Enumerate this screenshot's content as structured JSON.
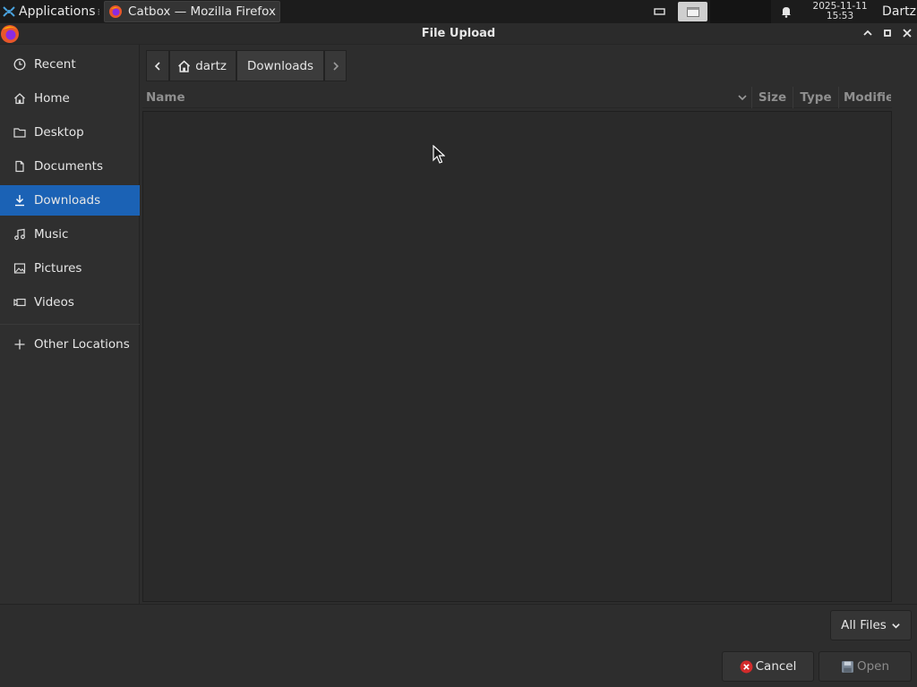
{
  "taskbar": {
    "applications_label": "Applications",
    "separator_glyph": "⁝",
    "active_window_title": "Catbox — Mozilla Firefox",
    "clock_date": "2025-11-11",
    "clock_time": "15:53",
    "user_name": "Dartz"
  },
  "dialog": {
    "title": "File Upload"
  },
  "sidebar": {
    "items": [
      {
        "label": "Recent",
        "icon": "clock-icon"
      },
      {
        "label": "Home",
        "icon": "home-icon"
      },
      {
        "label": "Desktop",
        "icon": "folder-icon"
      },
      {
        "label": "Documents",
        "icon": "document-icon"
      },
      {
        "label": "Downloads",
        "icon": "download-icon",
        "selected": true
      },
      {
        "label": "Music",
        "icon": "music-icon"
      },
      {
        "label": "Pictures",
        "icon": "picture-icon"
      },
      {
        "label": "Videos",
        "icon": "video-icon"
      }
    ],
    "other_locations": {
      "label": "Other Locations",
      "icon": "plus-icon"
    }
  },
  "pathbar": {
    "home_label": "dartz",
    "current_label": "Downloads"
  },
  "file_list": {
    "columns": [
      "Name",
      "Size",
      "Type",
      "Modified"
    ],
    "rows": []
  },
  "footer": {
    "filter_value": "All Files",
    "cancel_label": "Cancel",
    "open_label": "Open"
  },
  "colors": {
    "selection": "#1b62b5",
    "background": "#2d2d2d",
    "taskbar": "#1c1c1c"
  }
}
